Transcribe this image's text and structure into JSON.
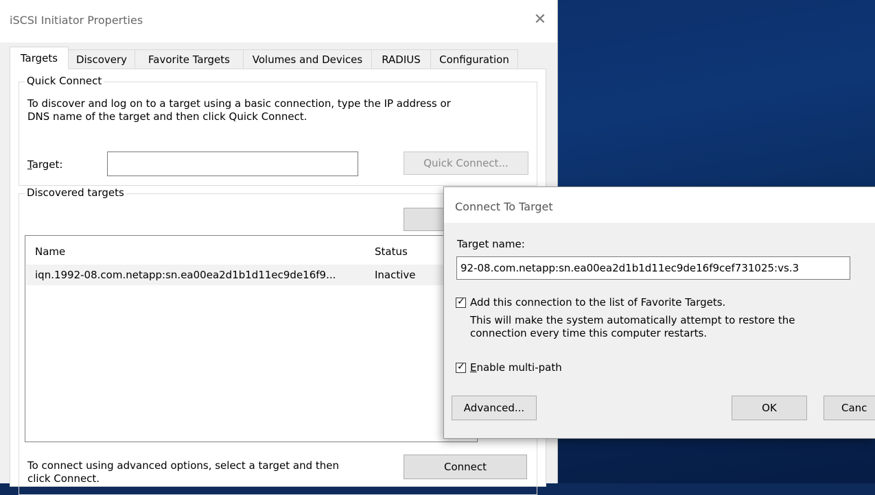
{
  "main_window": {
    "title": "iSCSI Initiator Properties",
    "close_glyph": "✕",
    "tabs": [
      "Targets",
      "Discovery",
      "Favorite Targets",
      "Volumes and Devices",
      "RADIUS",
      "Configuration"
    ],
    "quick_connect": {
      "group_label": "Quick Connect",
      "description_line1": "To discover and log on to a target using a basic connection, type the IP address or",
      "description_line2": "DNS name of the target and then click Quick Connect.",
      "target_label": "Target:",
      "target_value": "",
      "quick_connect_button": "Quick Connect..."
    },
    "discovered_targets": {
      "group_label": "Discovered targets",
      "columns": [
        "Name",
        "Status"
      ],
      "rows": [
        {
          "name": "iqn.1992-08.com.netapp:sn.ea00ea2d1b1d11ec9de16f9...",
          "status": "Inactive"
        }
      ],
      "connect_hint_line1": "To connect using advanced options, select a target and then",
      "connect_hint_line2": "click Connect.",
      "connect_button": "Connect"
    }
  },
  "connect_dialog": {
    "title": "Connect To Target",
    "target_name_label": "Target name:",
    "target_name_value": "92-08.com.netapp:sn.ea00ea2d1b1d11ec9de16f9cef731025:vs.3",
    "favorite_checkbox": {
      "checked": true,
      "label": "Add this connection to the list of Favorite Targets.",
      "note_line1": "This will make the system automatically attempt to restore the",
      "note_line2": "connection every time this computer restarts."
    },
    "multipath_checkbox": {
      "checked": true,
      "label": "Enable multi-path"
    },
    "advanced_button": "Advanced...",
    "ok_button": "OK",
    "cancel_button": "Canc"
  }
}
